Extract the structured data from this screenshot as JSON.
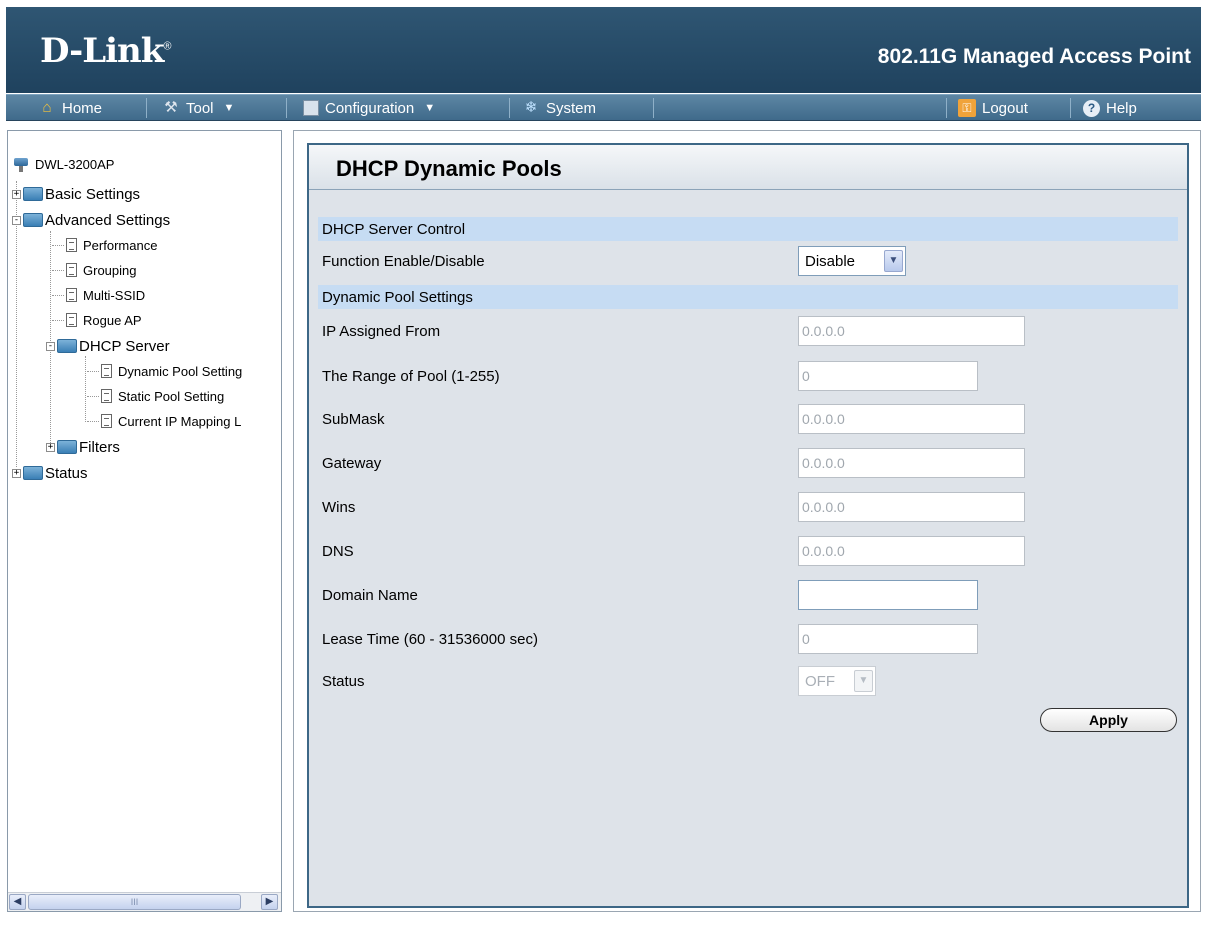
{
  "header": {
    "logo": "D-Link",
    "logo_mark": "®",
    "product": "802.11G Managed Access Point"
  },
  "menu": {
    "home": "Home",
    "tool": "Tool",
    "configuration": "Configuration",
    "system": "System",
    "logout": "Logout",
    "help": "Help"
  },
  "tree": {
    "root": "DWL-3200AP",
    "basic_settings": "Basic Settings",
    "advanced_settings": "Advanced Settings",
    "performance": "Performance",
    "grouping": "Grouping",
    "multi_ssid": "Multi-SSID",
    "rogue_ap": "Rogue AP",
    "dhcp_server": "DHCP Server",
    "dynamic_pool": "Dynamic Pool Setting",
    "static_pool": "Static Pool Setting",
    "current_ip": "Current IP Mapping L",
    "filters": "Filters",
    "status": "Status",
    "scroll_grip": "III"
  },
  "panel": {
    "title": "DHCP Dynamic Pools",
    "section_control": "DHCP Server Control",
    "function_label": "Function Enable/Disable",
    "function_value": "Disable",
    "section_pool": "Dynamic Pool Settings",
    "ip_from_label": "IP Assigned From",
    "ip_from_value": "0.0.0.0",
    "range_label": "The Range of Pool (1-255)",
    "range_value": "0",
    "submask_label": "SubMask",
    "submask_value": "0.0.0.0",
    "gateway_label": "Gateway",
    "gateway_value": "0.0.0.0",
    "wins_label": "Wins",
    "wins_value": "0.0.0.0",
    "dns_label": "DNS",
    "dns_value": "0.0.0.0",
    "domain_label": "Domain Name",
    "domain_value": "",
    "lease_label": "Lease Time (60 - 31536000 sec)",
    "lease_value": "0",
    "status_label": "Status",
    "status_value": "OFF",
    "apply_label": "Apply"
  },
  "icons": {
    "home": "home-icon",
    "tool": "tool-icon",
    "configuration": "save-disk-icon",
    "system": "system-icon",
    "logout": "key-icon",
    "help": "help-icon"
  },
  "colors": {
    "header_bg": "#2a4e6b",
    "menubar_bg": "#4f7a9a",
    "section_bar": "#c6dcf3",
    "panel_bg": "#dee3e9"
  }
}
